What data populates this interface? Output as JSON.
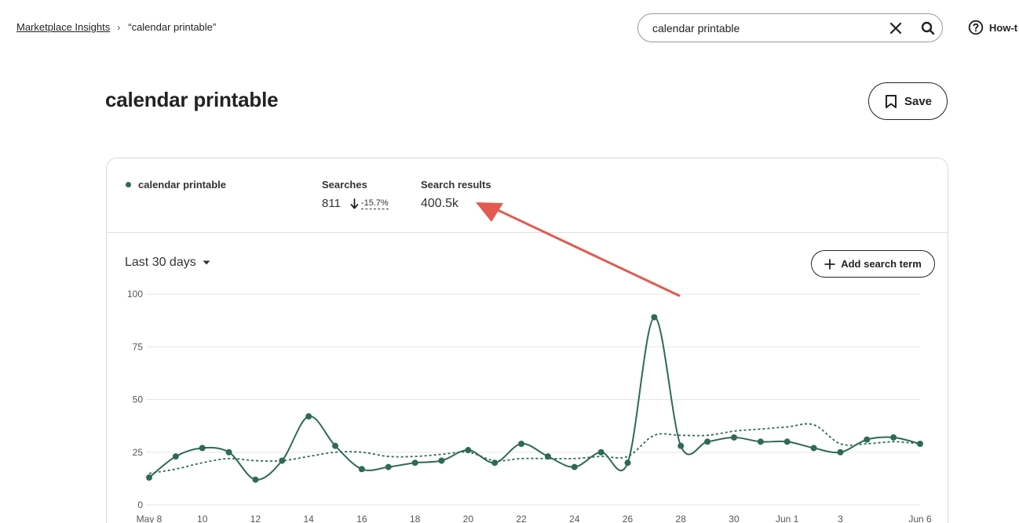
{
  "breadcrumb": {
    "root": "Marketplace Insights",
    "separator": "›",
    "current": "“calendar printable”"
  },
  "search": {
    "value": "calendar printable",
    "placeholder": ""
  },
  "help": {
    "label": "How-t"
  },
  "page": {
    "title": "calendar printable",
    "save_label": "Save"
  },
  "card": {
    "legend_label": "calendar printable",
    "searches_label": "Searches",
    "searches_value": "811",
    "searches_change": "-15.7%",
    "results_label": "Search results",
    "results_value": "400.5k",
    "range_label": "Last 30 days",
    "add_term_label": "Add search term"
  },
  "colors": {
    "series": "#2e6a56",
    "annotation": "#e25a4f"
  },
  "chart_data": {
    "type": "line",
    "x": [
      "May 8",
      "May 9",
      "May 10",
      "May 11",
      "May 12",
      "May 13",
      "May 14",
      "May 15",
      "May 16",
      "May 17",
      "May 18",
      "May 19",
      "May 20",
      "May 21",
      "May 22",
      "May 23",
      "May 24",
      "May 25",
      "May 26",
      "May 27",
      "May 28",
      "May 29",
      "May 30",
      "May 31",
      "Jun 1",
      "Jun 2",
      "Jun 3",
      "Jun 4",
      "Jun 5",
      "Jun 6"
    ],
    "tick_labels": [
      "May 8",
      "10",
      "12",
      "14",
      "16",
      "18",
      "20",
      "22",
      "24",
      "26",
      "28",
      "30",
      "Jun 1",
      "3",
      "Jun 6"
    ],
    "ylim": [
      0,
      100
    ],
    "yticks": [
      "100",
      "75",
      "50",
      "25",
      "0"
    ],
    "series": [
      {
        "name": "calendar printable",
        "style": "solid",
        "values": [
          13,
          23,
          27,
          25,
          12,
          21,
          42,
          28,
          17,
          18,
          20,
          21,
          26,
          20,
          29,
          23,
          18,
          25,
          20,
          89,
          28,
          30,
          32,
          30,
          30,
          27,
          25,
          31,
          32,
          29
        ]
      },
      {
        "style": "dashed",
        "values": [
          15,
          17,
          20,
          22,
          21,
          21,
          23,
          25,
          25,
          23,
          23,
          24,
          25,
          21,
          22,
          22,
          22,
          23,
          23,
          33,
          33,
          33,
          35,
          36,
          37,
          38,
          29,
          29,
          30,
          29
        ]
      }
    ],
    "grid": true,
    "legend": "top-left"
  }
}
